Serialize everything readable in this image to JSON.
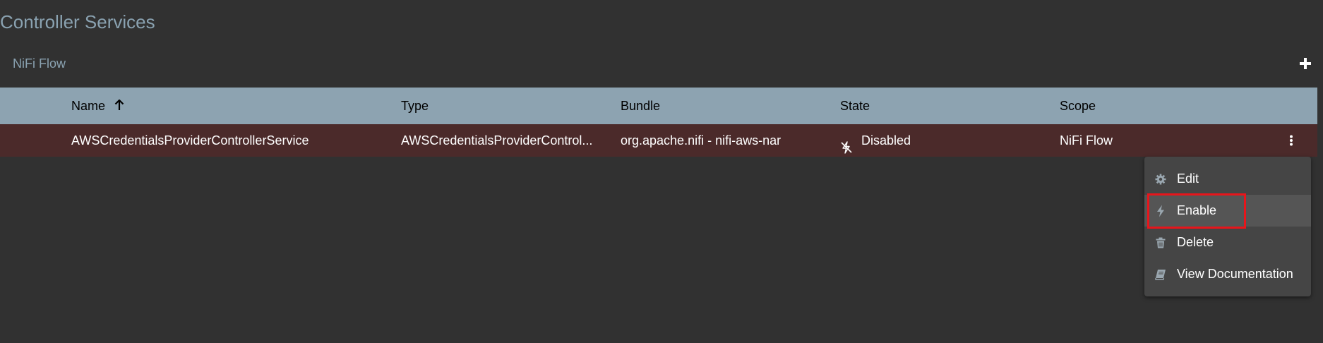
{
  "page": {
    "title": "Controller Services",
    "breadcrumb": "NiFi Flow",
    "add_icon": "plus-icon"
  },
  "table": {
    "columns": [
      {
        "label": "Name",
        "sorted": "ascending"
      },
      {
        "label": "Type"
      },
      {
        "label": "Bundle"
      },
      {
        "label": "State"
      },
      {
        "label": "Scope"
      }
    ],
    "rows": [
      {
        "name": "AWSCredentialsProviderControllerService",
        "type": "AWSCredentialsProviderControl...",
        "bundle": "org.apache.nifi - nifi-aws-nar",
        "state": "Disabled",
        "state_icon": "disabled-bolt-icon",
        "scope": "NiFi Flow"
      }
    ]
  },
  "context_menu": {
    "items": [
      {
        "label": "Edit",
        "icon": "gear-icon"
      },
      {
        "label": "Enable",
        "icon": "bolt-icon",
        "highlighted": true
      },
      {
        "label": "Delete",
        "icon": "trash-icon"
      },
      {
        "label": "View Documentation",
        "icon": "book-icon"
      }
    ]
  },
  "colors": {
    "background": "#313131",
    "title": "#8aa2b1",
    "header_bg": "#8da3b1",
    "row_bg": "#4b2a2a",
    "menu_bg": "#454545",
    "highlight": "#e8151b"
  }
}
